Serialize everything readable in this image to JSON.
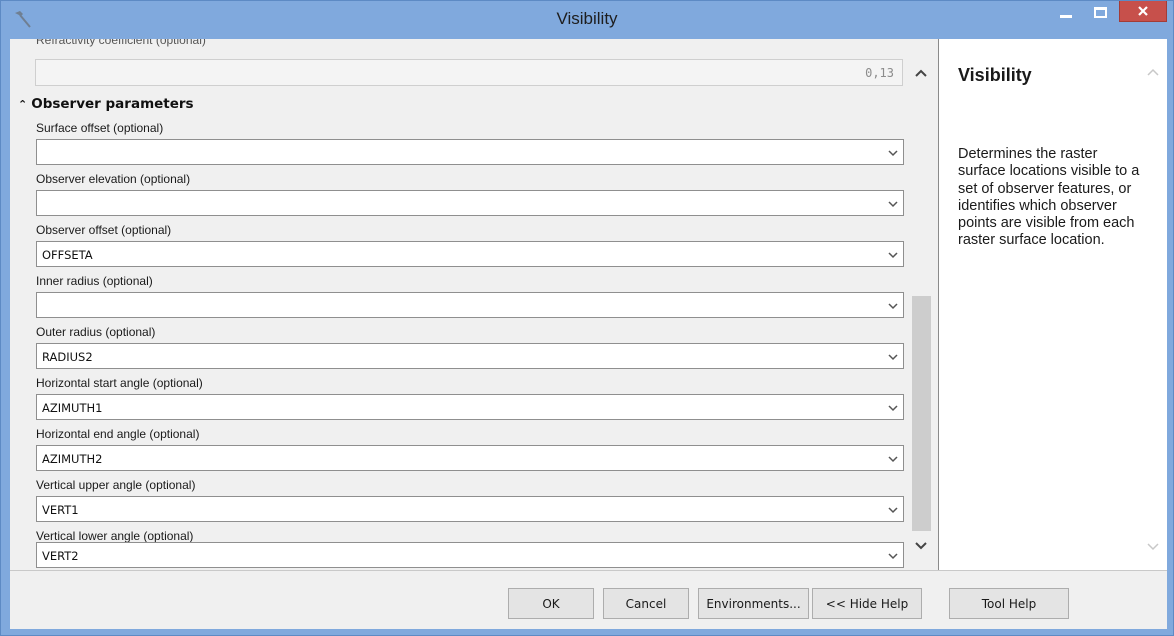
{
  "window": {
    "title": "Visibility",
    "icon": "hammer-icon"
  },
  "params": {
    "cut_label": "Refractivity coefficient (optional)",
    "refractivity_value": "0,13",
    "section_title": "Observer parameters",
    "fields": [
      {
        "label": "Surface offset (optional)",
        "value": ""
      },
      {
        "label": "Observer elevation (optional)",
        "value": ""
      },
      {
        "label": "Observer offset (optional)",
        "value": "OFFSETA"
      },
      {
        "label": "Inner radius (optional)",
        "value": ""
      },
      {
        "label": "Outer radius (optional)",
        "value": "RADIUS2"
      },
      {
        "label": "Horizontal start angle (optional)",
        "value": "AZIMUTH1"
      },
      {
        "label": "Horizontal end angle (optional)",
        "value": "AZIMUTH2"
      },
      {
        "label": "Vertical upper angle (optional)",
        "value": "VERT1"
      },
      {
        "label": "Vertical lower angle (optional)",
        "value": "VERT2"
      }
    ]
  },
  "help": {
    "title": "Visibility",
    "body": "Determines the raster surface locations visible to a set of observer features, or identifies which observer points are visible from each raster surface location."
  },
  "buttons": {
    "ok": "OK",
    "cancel": "Cancel",
    "environments": "Environments...",
    "hide_help": "<< Hide Help",
    "tool_help": "Tool Help"
  },
  "colors": {
    "titlebar": "#80a9dd",
    "close_button": "#c7504b",
    "pane_background": "#f0f0f0"
  }
}
